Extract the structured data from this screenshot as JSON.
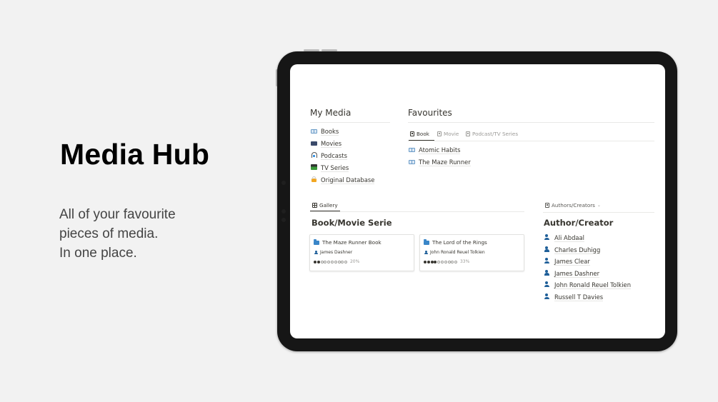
{
  "hero": {
    "title": "Media Hub",
    "subtitle_lines": [
      "All of your favourite",
      "pieces of media.",
      "In one place."
    ]
  },
  "my_media": {
    "heading": "My Media",
    "items": [
      {
        "label": "Books",
        "icon": "book-icon"
      },
      {
        "label": "Movies",
        "icon": "film-icon"
      },
      {
        "label": "Podcasts",
        "icon": "headphones-icon"
      },
      {
        "label": "TV Series",
        "icon": "clapper-icon"
      },
      {
        "label": "Original Database",
        "icon": "lock-icon"
      }
    ]
  },
  "favourites": {
    "heading": "Favourites",
    "tabs": [
      {
        "label": "Book",
        "active": true
      },
      {
        "label": "Movie",
        "active": false
      },
      {
        "label": "Podcast/TV Series",
        "active": false
      }
    ],
    "items": [
      {
        "label": "Atomic Habits",
        "icon": "book-icon"
      },
      {
        "label": "The Maze Runner",
        "icon": "book-icon"
      }
    ]
  },
  "gallery": {
    "view_tab": "Gallery",
    "heading": "Book/Movie Serie",
    "cards": [
      {
        "title": "The Maze Runner Book",
        "author": "James Dashner",
        "progress_filled": 2,
        "progress_total": 10,
        "progress_label": "20%"
      },
      {
        "title": "The Lord of the Rings",
        "author": "John Ronald Reuel Tolkien",
        "progress_filled": 4,
        "progress_total": 10,
        "progress_label": "33%"
      }
    ]
  },
  "authors": {
    "view_tab": "Authors/Creators",
    "heading": "Author/Creator",
    "items": [
      "Ali Abdaal",
      "Charles Duhigg",
      "James Clear",
      "James Dashner",
      "John Ronald Reuel Tolkien",
      "Russell T Davies"
    ]
  },
  "colors": {
    "background": "#f2f2f2",
    "device_frame": "#161616",
    "text": "#37352f",
    "muted": "#9b9a97",
    "person_icon": "#1f5f99",
    "folder_icon": "#3a86c8"
  }
}
